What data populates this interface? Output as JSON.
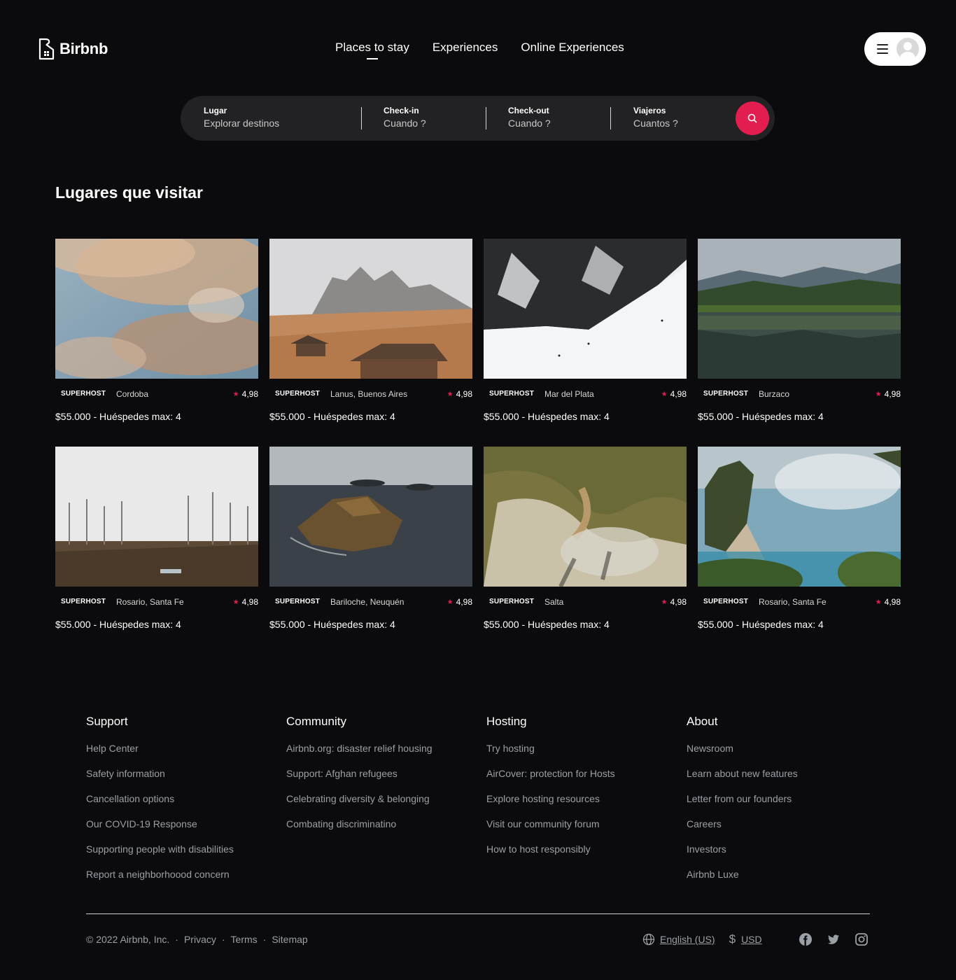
{
  "header": {
    "brand": "Birbnb",
    "nav": [
      "Places to stay",
      "Experiences",
      "Online Experiences"
    ]
  },
  "search": {
    "place_label": "Lugar",
    "place_value": "Explorar destinos",
    "checkin_label": "Check-in",
    "checkin_value": "Cuando ?",
    "checkout_label": "Check-out",
    "checkout_value": "Cuando ?",
    "guests_label": "Viajeros",
    "guests_value": "Cuantos ?"
  },
  "main": {
    "title": "Lugares que visitar",
    "listings": [
      {
        "badge": "SUPERHOST",
        "location": "Cordoba",
        "rating": "4,98",
        "price": "$55.000 - Huéspedes max: 4"
      },
      {
        "badge": "SUPERHOST",
        "location": "Lanus, Buenos Aires",
        "rating": "4,98",
        "price": "$55.000 - Huéspedes max: 4"
      },
      {
        "badge": "SUPERHOST",
        "location": "Mar del Plata",
        "rating": "4,98",
        "price": "$55.000 - Huéspedes max: 4"
      },
      {
        "badge": "SUPERHOST",
        "location": "Burzaco",
        "rating": "4,98",
        "price": "$55.000 - Huéspedes max: 4"
      },
      {
        "badge": "SUPERHOST",
        "location": "Rosario, Santa Fe",
        "rating": "4,98",
        "price": "$55.000 - Huéspedes max: 4"
      },
      {
        "badge": "SUPERHOST",
        "location": "Bariloche, Neuquén",
        "rating": "4,98",
        "price": "$55.000 - Huéspedes max: 4"
      },
      {
        "badge": "SUPERHOST",
        "location": "Salta",
        "rating": "4,98",
        "price": "$55.000 - Huéspedes max: 4"
      },
      {
        "badge": "SUPERHOST",
        "location": "Rosario, Santa Fe",
        "rating": "4,98",
        "price": "$55.000 - Huéspedes max: 4"
      }
    ]
  },
  "footer": {
    "support": {
      "title": "Support",
      "links": [
        "Help Center",
        "Safety information",
        "Cancellation options",
        "Our COVID-19 Response",
        "Supporting people with disabilities",
        "Report a neighborhoood concern"
      ]
    },
    "community": {
      "title": "Community",
      "links": [
        "Airbnb.org: disaster relief housing",
        "Support: Afghan refugees",
        "Celebrating diversity & belonging",
        "Combating discriminatino"
      ]
    },
    "hosting": {
      "title": "Hosting",
      "links": [
        "Try hosting",
        "AirCover: protection for Hosts",
        "Explore hosting resources",
        "Visit our community forum",
        "How to host responsibly"
      ]
    },
    "about": {
      "title": "About",
      "links": [
        "Newsroom",
        "Learn about new features",
        "Letter from our founders",
        "Careers",
        "Investors",
        "Airbnb Luxe"
      ]
    },
    "copyright": "© 2022 Airbnb, Inc.",
    "privacy": "Privacy",
    "terms": "Terms",
    "sitemap": "Sitemap",
    "separator": "·",
    "language": "English (US)",
    "currency_symbol": "$",
    "currency": "USD"
  },
  "colors": {
    "accent": "#e21d4f",
    "background": "#0b0b0d"
  }
}
